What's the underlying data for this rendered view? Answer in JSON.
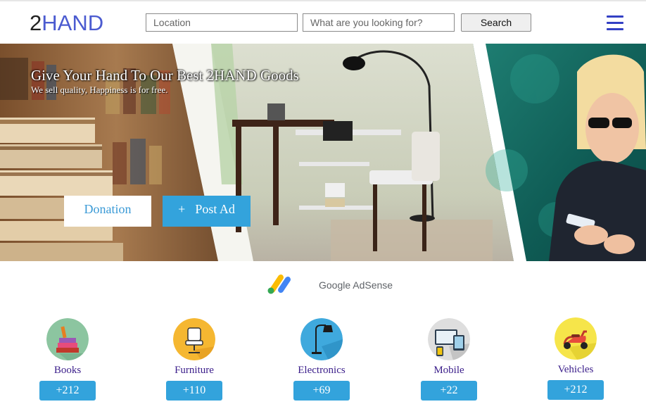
{
  "header": {
    "logo_number": "2",
    "logo_word": "HAND",
    "location_placeholder": "Location",
    "search_placeholder": "What are you looking for?",
    "search_label": "Search",
    "menu_icon": "hamburger-menu-icon"
  },
  "hero": {
    "title": "Give Your Hand To Our Best 2HAND Goods",
    "subtitle": "We sell quality, Happiness is for free.",
    "donation_label": "Donation",
    "post_ad_plus": "+",
    "post_ad_label": "Post Ad"
  },
  "ads": {
    "provider": "Google AdSense"
  },
  "categories": [
    {
      "label": "Books",
      "count": "+212",
      "icon": "books-icon"
    },
    {
      "label": "Furniture",
      "count": "+110",
      "icon": "chair-icon"
    },
    {
      "label": "Electronics",
      "count": "+69",
      "icon": "lamp-icon"
    },
    {
      "label": "Mobile",
      "count": "+22",
      "icon": "devices-icon"
    },
    {
      "label": "Vehicles",
      "count": "+212",
      "icon": "scooter-icon"
    }
  ],
  "colors": {
    "brand": "#4b5bd0",
    "accent": "#33a3dc",
    "category_text": "#3a1d8a"
  }
}
